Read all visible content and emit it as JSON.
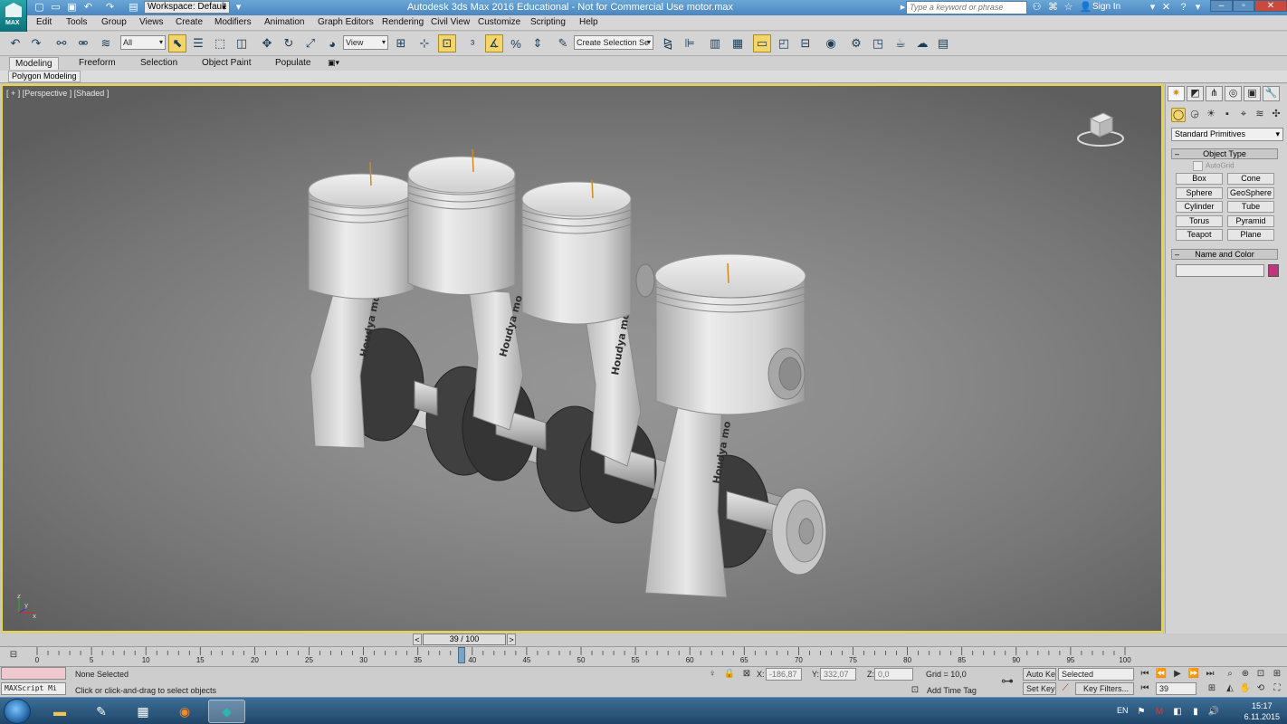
{
  "title": {
    "app_text": "Autodesk 3ds Max 2016 Educational - Not for Commercial Use   motor.max",
    "logo_text": "MAX",
    "workspace": "Workspace: Default",
    "search_placeholder": "Type a keyword or phrase",
    "signin": "Sign In"
  },
  "menu": [
    "Edit",
    "Tools",
    "Group",
    "Views",
    "Create",
    "Modifiers",
    "Animation",
    "Graph Editors",
    "Rendering",
    "Civil View",
    "Customize",
    "Scripting",
    "Help"
  ],
  "toolbar": {
    "selection_filter": "All",
    "ref_coord": "View",
    "named_selection": "Create Selection Se"
  },
  "ribbon": {
    "tabs": [
      "Modeling",
      "Freeform",
      "Selection",
      "Object Paint",
      "Populate"
    ],
    "sub_label": "Polygon Modeling"
  },
  "viewport": {
    "label": "[ + ] [Perspective ] [Shaded ]",
    "rod_text": "Houdya mo"
  },
  "command_panel": {
    "dropdown": "Standard Primitives",
    "object_type_title": "Object Type",
    "autogrid_label": "AutoGrid",
    "primitives": [
      "Box",
      "Cone",
      "Sphere",
      "GeoSphere",
      "Cylinder",
      "Tube",
      "Torus",
      "Pyramid",
      "Teapot",
      "Plane"
    ],
    "name_color_title": "Name and Color",
    "swatch_color": "#c1347b"
  },
  "timeline": {
    "frame_display": "39 / 100",
    "current_frame": 39,
    "total_frames": 100,
    "tick_labels": [
      "0",
      "5",
      "10",
      "15",
      "20",
      "25",
      "30",
      "35",
      "40",
      "45",
      "50",
      "55",
      "60",
      "65",
      "70",
      "75",
      "80",
      "85",
      "90",
      "95",
      "100"
    ]
  },
  "status": {
    "maxscript": "MAXScript Mi",
    "selection": "None Selected",
    "prompt": "Click or click-and-drag to select objects",
    "x_label": "X:",
    "x_value": "-186,87",
    "y_label": "Y:",
    "y_value": "332,07",
    "z_label": "Z:",
    "z_value": "0,0",
    "grid": "Grid = 10,0",
    "add_time_tag": "Add Time Tag",
    "auto_key": "Auto Key",
    "set_key": "Set Key",
    "key_mode": "Selected",
    "key_filters": "Key Filters...",
    "frame_field": "39"
  },
  "taskbar": {
    "lang": "EN",
    "time": "15:17",
    "date": "6.11.2015"
  }
}
